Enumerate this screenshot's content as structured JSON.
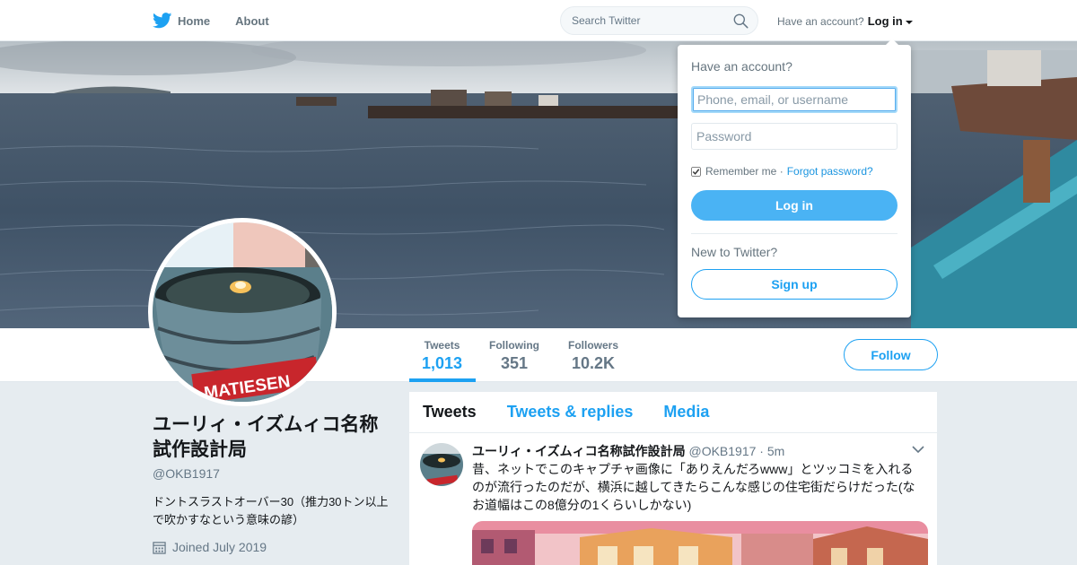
{
  "nav": {
    "home_label": "Home",
    "about_label": "About",
    "search_placeholder": "Search Twitter",
    "have_account": "Have an account?",
    "login_label": "Log in"
  },
  "profile": {
    "name": "ユーリィ・イズムィコ名称試作設計局",
    "handle": "@OKB1917",
    "bio": "ドントスラストオーバー30（推力30トン以上で吹かすなという意味の諺）",
    "joined": "Joined July 2019",
    "avatar_text": "MATIESEN",
    "follow_label": "Follow"
  },
  "stats": [
    {
      "label": "Tweets",
      "value": "1,013",
      "active": true
    },
    {
      "label": "Following",
      "value": "351",
      "active": false
    },
    {
      "label": "Followers",
      "value": "10.2K",
      "active": false
    }
  ],
  "tabs": [
    {
      "label": "Tweets",
      "active": true
    },
    {
      "label": "Tweets & replies",
      "active": false
    },
    {
      "label": "Media",
      "active": false
    }
  ],
  "tweet": {
    "name": "ユーリィ・イズムィコ名称試作設計局",
    "handle": "@OKB1917",
    "time": "· 5m",
    "text": "昔、ネットでこのキャプチャ画像に「ありえんだろwww」とツッコミを入れるのが流行ったのだが、横浜に越してきたらこんな感じの住宅街だらけだった(なお道幅はこの8億分の1くらいしかない)"
  },
  "login_dropdown": {
    "title": "Have an account?",
    "username_placeholder": "Phone, email, or username",
    "password_placeholder": "Password",
    "remember_label": "Remember me ·",
    "forgot_label": "Forgot password?",
    "login_button": "Log in",
    "new_label": "New to Twitter?",
    "signup_button": "Sign up"
  },
  "colors": {
    "brand": "#1da1f2",
    "login_button": "#4ab3f4",
    "background": "#e6ecf0"
  }
}
